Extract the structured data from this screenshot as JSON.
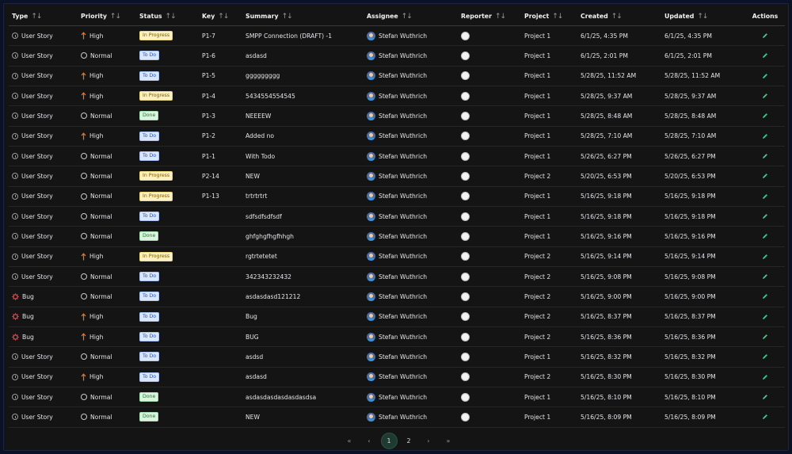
{
  "columns": [
    {
      "key": "type",
      "label": "Type"
    },
    {
      "key": "priority",
      "label": "Priority"
    },
    {
      "key": "status",
      "label": "Status"
    },
    {
      "key": "key",
      "label": "Key"
    },
    {
      "key": "summary",
      "label": "Summary"
    },
    {
      "key": "assignee",
      "label": "Assignee"
    },
    {
      "key": "reporter",
      "label": "Reporter"
    },
    {
      "key": "project",
      "label": "Project"
    },
    {
      "key": "created",
      "label": "Created"
    },
    {
      "key": "updated",
      "label": "Updated"
    },
    {
      "key": "actions",
      "label": "Actions"
    }
  ],
  "sort_glyph": "↑↓",
  "rows": [
    {
      "type": "User Story",
      "priority": "High",
      "status": "In Progress",
      "key": "P1-7",
      "summary": "SMPP Connection (DRAFT) -1",
      "assignee": "Stefan Wuthrich",
      "project": "Project 1",
      "created": "6/1/25, 4:35 PM",
      "updated": "6/1/25, 4:35 PM"
    },
    {
      "type": "User Story",
      "priority": "Normal",
      "status": "To Do",
      "key": "P1-6",
      "summary": "asdasd",
      "assignee": "Stefan Wuthrich",
      "project": "Project 1",
      "created": "6/1/25, 2:01 PM",
      "updated": "6/1/25, 2:01 PM"
    },
    {
      "type": "User Story",
      "priority": "High",
      "status": "To Do",
      "key": "P1-5",
      "summary": "ggggggggg",
      "assignee": "Stefan Wuthrich",
      "project": "Project 1",
      "created": "5/28/25, 11:52 AM",
      "updated": "5/28/25, 11:52 AM"
    },
    {
      "type": "User Story",
      "priority": "High",
      "status": "In Progress",
      "key": "P1-4",
      "summary": "5434554554545",
      "assignee": "Stefan Wuthrich",
      "project": "Project 1",
      "created": "5/28/25, 9:37 AM",
      "updated": "5/28/25, 9:37 AM"
    },
    {
      "type": "User Story",
      "priority": "Normal",
      "status": "Done",
      "key": "P1-3",
      "summary": "NEEEEW",
      "assignee": "Stefan Wuthrich",
      "project": "Project 1",
      "created": "5/28/25, 8:48 AM",
      "updated": "5/28/25, 8:48 AM"
    },
    {
      "type": "User Story",
      "priority": "High",
      "status": "To Do",
      "key": "P1-2",
      "summary": "Added no",
      "assignee": "Stefan Wuthrich",
      "project": "Project 1",
      "created": "5/28/25, 7:10 AM",
      "updated": "5/28/25, 7:10 AM"
    },
    {
      "type": "User Story",
      "priority": "Normal",
      "status": "To Do",
      "key": "P1-1",
      "summary": "With Todo",
      "assignee": "Stefan Wuthrich",
      "project": "Project 1",
      "created": "5/26/25, 6:27 PM",
      "updated": "5/26/25, 6:27 PM"
    },
    {
      "type": "User Story",
      "priority": "Normal",
      "status": "In Progress",
      "key": "P2-14",
      "summary": "NEW",
      "assignee": "Stefan Wuthrich",
      "project": "Project 2",
      "created": "5/20/25, 6:53 PM",
      "updated": "5/20/25, 6:53 PM"
    },
    {
      "type": "User Story",
      "priority": "Normal",
      "status": "In Progress",
      "key": "P1-13",
      "summary": "trtrtrtrt",
      "assignee": "Stefan Wuthrich",
      "project": "Project 1",
      "created": "5/16/25, 9:18 PM",
      "updated": "5/16/25, 9:18 PM"
    },
    {
      "type": "User Story",
      "priority": "Normal",
      "status": "To Do",
      "key": "",
      "summary": "sdfsdfsdfsdf",
      "assignee": "Stefan Wuthrich",
      "project": "Project 1",
      "created": "5/16/25, 9:18 PM",
      "updated": "5/16/25, 9:18 PM"
    },
    {
      "type": "User Story",
      "priority": "Normal",
      "status": "Done",
      "key": "",
      "summary": "ghfghgfhgfhhgh",
      "assignee": "Stefan Wuthrich",
      "project": "Project 1",
      "created": "5/16/25, 9:16 PM",
      "updated": "5/16/25, 9:16 PM"
    },
    {
      "type": "User Story",
      "priority": "High",
      "status": "In Progress",
      "key": "",
      "summary": "rgtrtetetet",
      "assignee": "Stefan Wuthrich",
      "project": "Project 2",
      "created": "5/16/25, 9:14 PM",
      "updated": "5/16/25, 9:14 PM"
    },
    {
      "type": "User Story",
      "priority": "Normal",
      "status": "To Do",
      "key": "",
      "summary": "342343232432",
      "assignee": "Stefan Wuthrich",
      "project": "Project 2",
      "created": "5/16/25, 9:08 PM",
      "updated": "5/16/25, 9:08 PM"
    },
    {
      "type": "Bug",
      "priority": "Normal",
      "status": "To Do",
      "key": "",
      "summary": "asdasdasd121212",
      "assignee": "Stefan Wuthrich",
      "project": "Project 2",
      "created": "5/16/25, 9:00 PM",
      "updated": "5/16/25, 9:00 PM"
    },
    {
      "type": "Bug",
      "priority": "High",
      "status": "To Do",
      "key": "",
      "summary": "Bug",
      "assignee": "Stefan Wuthrich",
      "project": "Project 2",
      "created": "5/16/25, 8:37 PM",
      "updated": "5/16/25, 8:37 PM"
    },
    {
      "type": "Bug",
      "priority": "High",
      "status": "To Do",
      "key": "",
      "summary": "BUG",
      "assignee": "Stefan Wuthrich",
      "project": "Project 2",
      "created": "5/16/25, 8:36 PM",
      "updated": "5/16/25, 8:36 PM"
    },
    {
      "type": "User Story",
      "priority": "Normal",
      "status": "To Do",
      "key": "",
      "summary": "asdsd",
      "assignee": "Stefan Wuthrich",
      "project": "Project 1",
      "created": "5/16/25, 8:32 PM",
      "updated": "5/16/25, 8:32 PM"
    },
    {
      "type": "User Story",
      "priority": "High",
      "status": "To Do",
      "key": "",
      "summary": "asdasd",
      "assignee": "Stefan Wuthrich",
      "project": "Project 2",
      "created": "5/16/25, 8:30 PM",
      "updated": "5/16/25, 8:30 PM"
    },
    {
      "type": "User Story",
      "priority": "Normal",
      "status": "Done",
      "key": "",
      "summary": "asdasdasdasdasdasdsa",
      "assignee": "Stefan Wuthrich",
      "project": "Project 1",
      "created": "5/16/25, 8:10 PM",
      "updated": "5/16/25, 8:10 PM"
    },
    {
      "type": "User Story",
      "priority": "Normal",
      "status": "Done",
      "key": "",
      "summary": "NEW",
      "assignee": "Stefan Wuthrich",
      "project": "Project 1",
      "created": "5/16/25, 8:09 PM",
      "updated": "5/16/25, 8:09 PM"
    }
  ],
  "pagination": {
    "first_label": "«",
    "prev_label": "‹",
    "pages": [
      "1",
      "2"
    ],
    "current": "1",
    "next_label": "›",
    "last_label": "»"
  },
  "colors": {
    "high_priority": "#f0721e",
    "bug": "#e5484d",
    "edit_icon": "#3ecf8e",
    "background": "#141414"
  },
  "icons": {
    "user_story": "clock-circle-icon",
    "bug": "bug-icon",
    "high": "arrow-up-icon",
    "normal": "circle-icon",
    "edit": "pencil-icon",
    "reporter": "empty-avatar-icon"
  }
}
